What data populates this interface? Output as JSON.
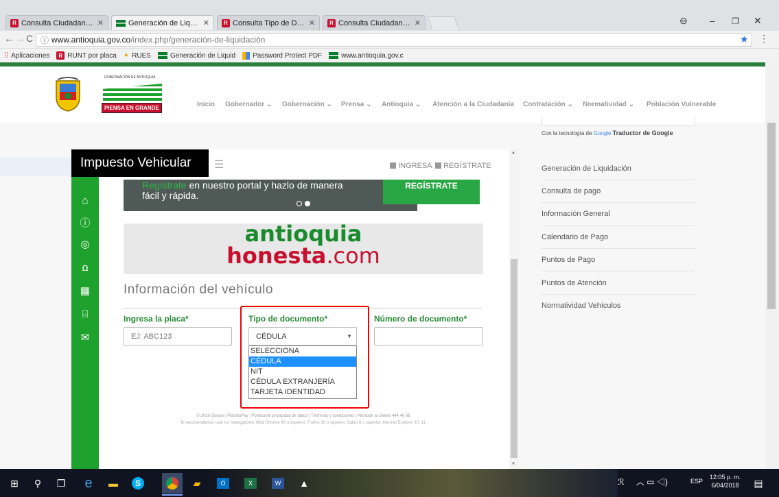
{
  "browser": {
    "tabs": [
      {
        "label": "Consulta Ciudadano - RU",
        "favicon": "runt-icon",
        "active": false
      },
      {
        "label": "Generación de Liquidació",
        "favicon": "antioquia-flag-icon",
        "active": true
      },
      {
        "label": "Consulta Tipo de Docum",
        "favicon": "runt-icon",
        "active": false
      },
      {
        "label": "Consulta Ciudadano - RU",
        "favicon": "runt-icon",
        "active": false
      }
    ],
    "url_host": "www.antioquia.gov.co",
    "url_path": "/index.php/generación-de-liquidación",
    "bookmarks": [
      "Aplicaciones",
      "RUNT por placa",
      "RUES",
      "Generación de Liquid",
      "Password Protect PDF",
      "www.antioquia.gov.c"
    ]
  },
  "site": {
    "logo_top": "GOBERNACIÓN DE ANTIOQUIA",
    "logo_badge": "PIENSA EN GRANDE",
    "nav": [
      "Inicio",
      "Gobernador ⌄",
      "Gobernación ⌄",
      "Prensa ⌄",
      "Antioquia ⌄",
      "Atención a la Ciudadanía",
      "Contratación ⌄",
      "Normatividad ⌄",
      "Población Vulnerable"
    ],
    "translator_note": "Con la tecnología de",
    "translator_google": "Google",
    "translator_name": "Traductor de Google",
    "sidebar_links": [
      "Generación de Liquidación",
      "Consulta de pago",
      "Información General",
      "Calendario de Pago",
      "Puntos de Pago",
      "Puntos de Atención",
      "Normatividad Vehículos"
    ]
  },
  "widget": {
    "title": "Impuesto Vehicular",
    "ingresa": "INGRESA",
    "registrate": "REGÍSTRATE",
    "banner_highlight": "Regístrate",
    "banner_text_1": " en nuestro portal y hazlo de manera",
    "banner_text_2": "fácil y rápida.",
    "banner_button": "REGÍSTRATE",
    "brand_line1": "antioquia",
    "brand_line2a": "honesta",
    "brand_line2b": ".com",
    "section_title": "Información del vehículo",
    "placa_label": "Ingresa la placa*",
    "placa_placeholder": "EJ: ABC123",
    "tipo_label": "Tipo de documento*",
    "tipo_value": "CÉDULA",
    "tipo_options": [
      "SELECCIONA",
      "CÉDULA",
      "NIT",
      "CÉDULA EXTRANJERÍA",
      "TARJETA IDENTIDAD"
    ],
    "tipo_selected_index": 1,
    "numero_label": "Número de documento*",
    "footer_line1": "© 2018 Quipux | PlacetoPay | Política de privacidad de datos | Términos y condiciones | Atención al cliente 444 46 66",
    "footer_line2": "Te recomendamos usar los navegadores Web Chrome 43 o superior, Firefox 38 o superior, Safari 8 o superior, Internet Explorer 10, 11."
  },
  "taskbar": {
    "lang": "ESP",
    "time": "12:05 p. m.",
    "date": "6/04/2018"
  }
}
